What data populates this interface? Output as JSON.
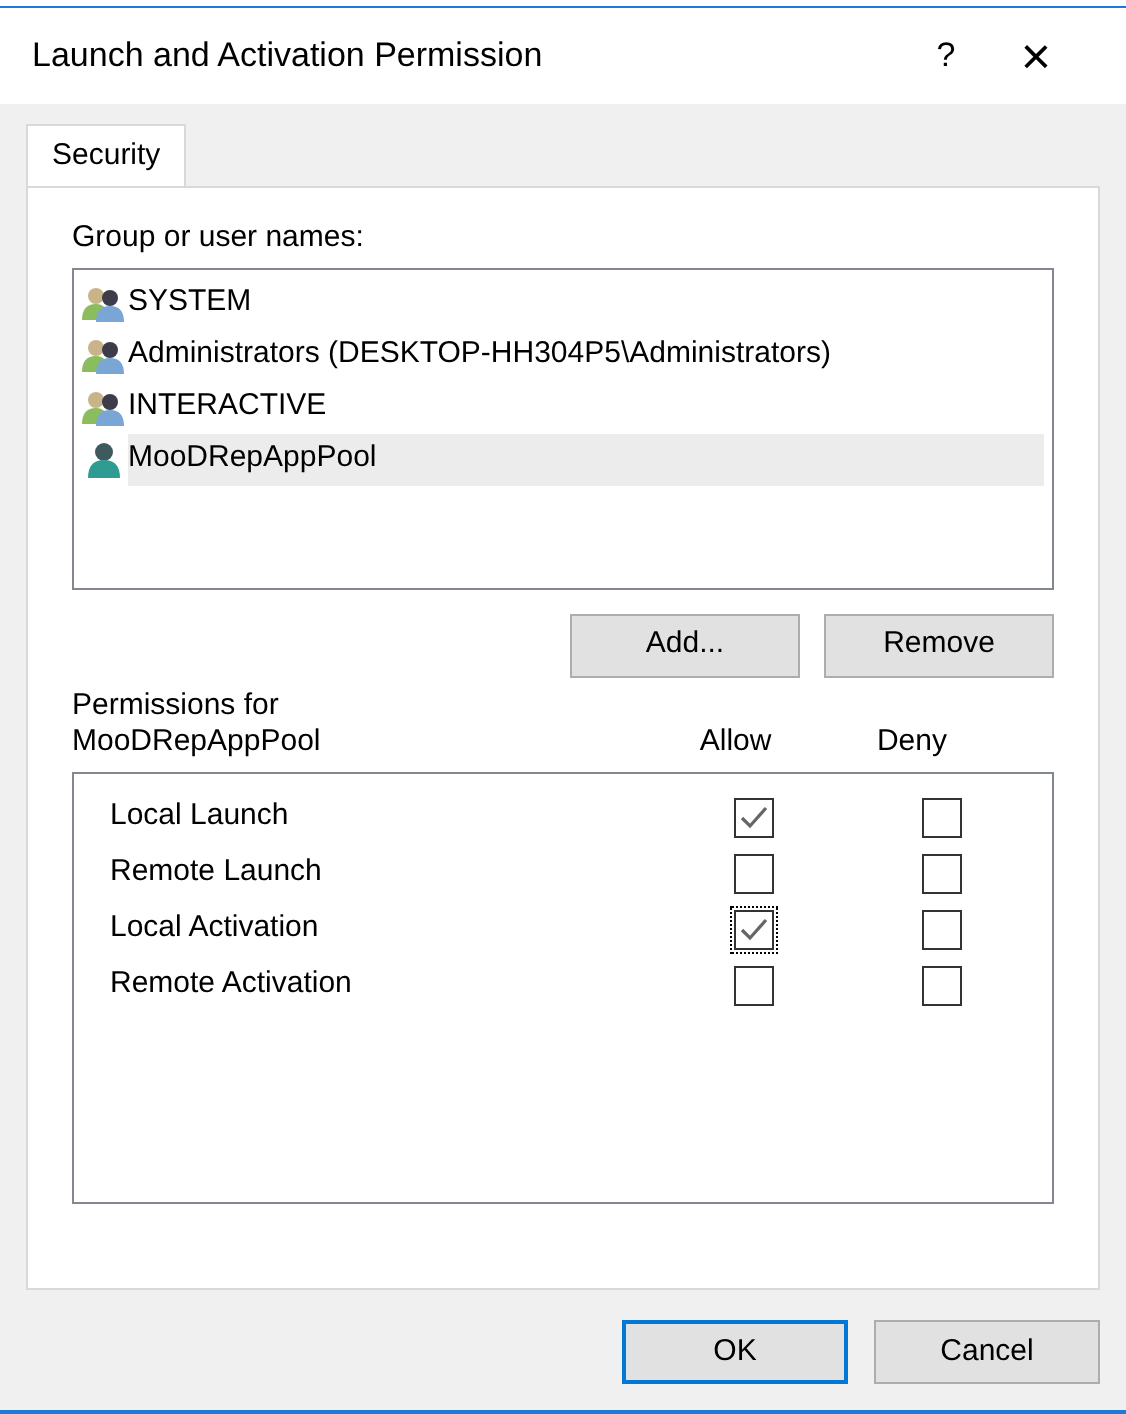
{
  "window": {
    "title": "Launch and Activation Permission",
    "help": "?",
    "close": "×"
  },
  "tabs": [
    {
      "label": "Security",
      "selected": true
    }
  ],
  "group_label": "Group or user names:",
  "users": [
    {
      "name": "SYSTEM",
      "kind": "group",
      "selected": false
    },
    {
      "name": "Administrators (DESKTOP-HH304P5\\Administrators)",
      "kind": "group",
      "selected": false
    },
    {
      "name": "INTERACTIVE",
      "kind": "group",
      "selected": false
    },
    {
      "name": "MooDRepAppPool",
      "kind": "user",
      "selected": true
    }
  ],
  "user_buttons": [
    "Add...",
    "Remove"
  ],
  "permissions_label": "Permissions for\nMooDRepAppPool",
  "columns": [
    "Allow",
    "Deny"
  ],
  "permissions": [
    {
      "name": "Local Launch",
      "allow": true,
      "deny": false,
      "focused": false
    },
    {
      "name": "Remote Launch",
      "allow": false,
      "deny": false,
      "focused": false
    },
    {
      "name": "Local Activation",
      "allow": true,
      "deny": false,
      "focused": true
    },
    {
      "name": "Remote Activation",
      "allow": false,
      "deny": false,
      "focused": false
    }
  ],
  "buttons": [
    {
      "label": "OK",
      "default": true
    },
    {
      "label": "Cancel",
      "default": false
    }
  ]
}
